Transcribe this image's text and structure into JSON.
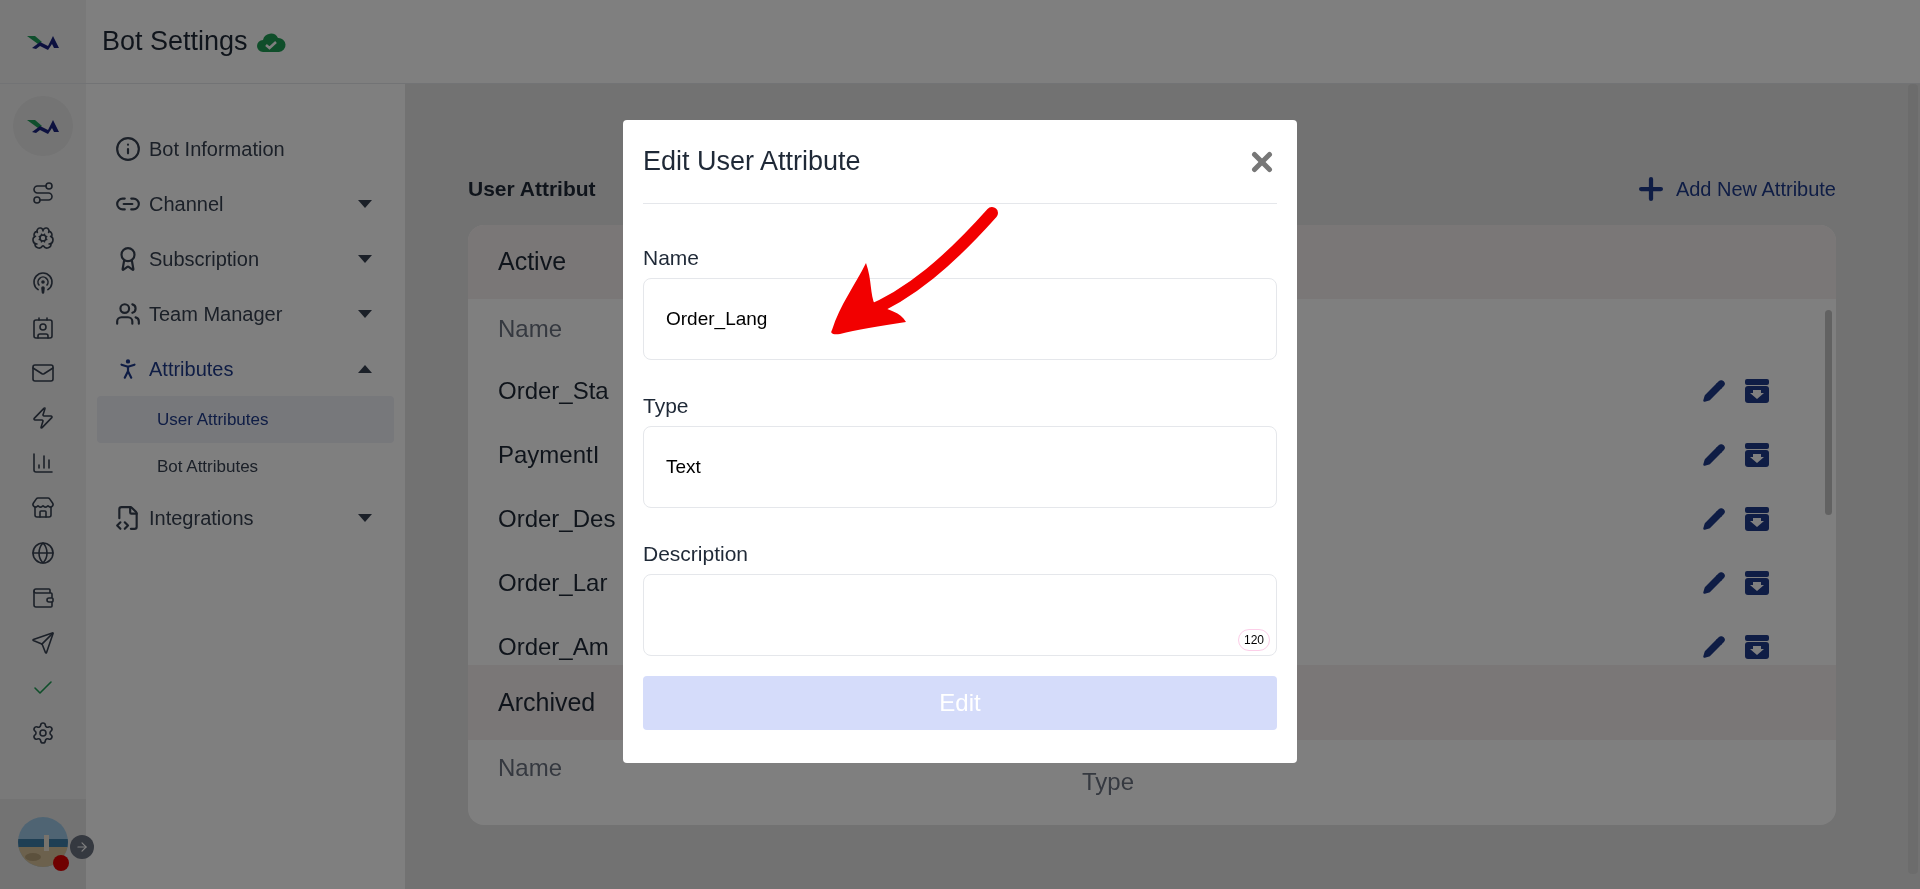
{
  "header": {
    "title": "Bot Settings",
    "saved": true
  },
  "sidebar": {
    "items": [
      {
        "label": "Bot Information",
        "kind": "link"
      },
      {
        "label": "Channel",
        "kind": "group",
        "expanded": false
      },
      {
        "label": "Subscription",
        "kind": "group",
        "expanded": false
      },
      {
        "label": "Team Manager",
        "kind": "group",
        "expanded": false
      },
      {
        "label": "Attributes",
        "kind": "group",
        "expanded": true,
        "children": [
          {
            "label": "User Attributes",
            "selected": true
          },
          {
            "label": "Bot Attributes",
            "selected": false
          }
        ]
      },
      {
        "label": "Integrations",
        "kind": "group",
        "expanded": false
      }
    ]
  },
  "main": {
    "title": "User Attribut",
    "add_button": "Add New Attribute",
    "active": {
      "heading": "Active",
      "columns": [
        "Name"
      ],
      "rows": [
        "Order_Sta",
        "PaymentI",
        "Order_Des",
        "Order_Lar",
        "Order_Am"
      ]
    },
    "archived": {
      "heading": "Archived",
      "columns": [
        "Name",
        "Type"
      ]
    }
  },
  "modal": {
    "title": "Edit User Attribute",
    "fields": [
      {
        "label": "Name",
        "kind": "input",
        "value": "Order_Lang"
      },
      {
        "label": "Type",
        "kind": "input",
        "value": "Text"
      },
      {
        "label": "Description",
        "kind": "textarea",
        "counter": "120"
      }
    ],
    "submit": {
      "label": "Edit",
      "disabled": true
    }
  }
}
